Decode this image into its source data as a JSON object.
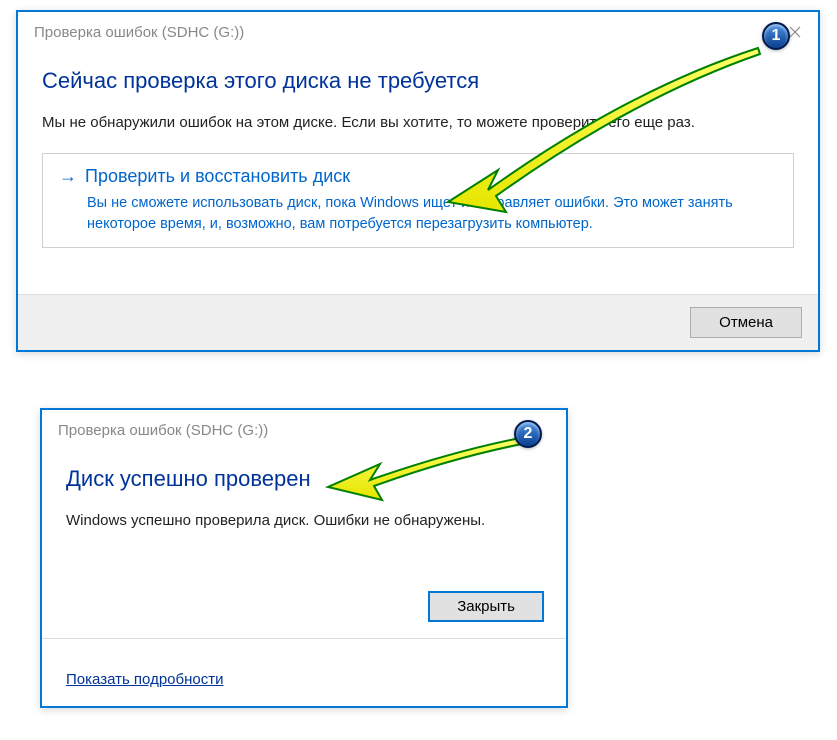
{
  "dialog1": {
    "title": "Проверка ошибок (SDHC (G:))",
    "heading": "Сейчас проверка этого диска не требуется",
    "body": "Мы не обнаружили ошибок на этом диске. Если вы хотите, то можете проверить его еще раз.",
    "option": {
      "title": "Проверить и восстановить диск",
      "desc": "Вы не сможете использовать диск, пока Windows ищет и исправляет ошибки. Это может занять некоторое время, и, возможно, вам потребуется перезагрузить компьютер."
    },
    "cancel_label": "Отмена"
  },
  "dialog2": {
    "title": "Проверка ошибок (SDHC (G:))",
    "heading": "Диск успешно проверен",
    "body": "Windows успешно проверила диск. Ошибки не обнаружены.",
    "close_label": "Закрыть",
    "details_label": "Показать подробности"
  },
  "badges": {
    "num1": "1",
    "num2": "2"
  }
}
